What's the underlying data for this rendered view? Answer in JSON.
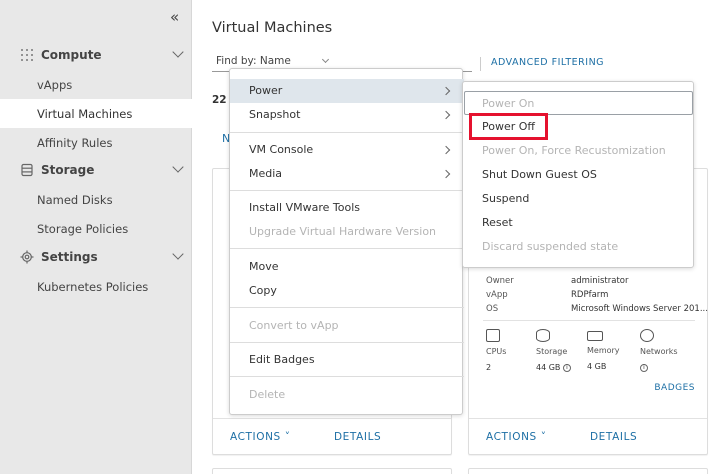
{
  "sidebar": {
    "collapse_glyph": "«",
    "groups": [
      {
        "label": "Compute",
        "icon": "grid-icon"
      },
      {
        "label": "Storage",
        "icon": "database-icon"
      },
      {
        "label": "Settings",
        "icon": "gear-icon"
      }
    ],
    "compute_items": [
      "vApps",
      "Virtual Machines",
      "Affinity Rules"
    ],
    "storage_items": [
      "Named Disks",
      "Storage Policies"
    ],
    "settings_items": [
      "Kubernetes Policies"
    ],
    "active_item": "Virtual Machines"
  },
  "main": {
    "title": "Virtual Machines",
    "find_by_label": "Find by:",
    "find_by_value": "Name",
    "advanced_filtering": "ADVANCED FILTERING",
    "count": "22",
    "new_vm_partial": "N"
  },
  "context_menu": {
    "items": [
      {
        "label": "Power",
        "submenu": true,
        "disabled": false,
        "highlighted": true
      },
      {
        "label": "Snapshot",
        "submenu": true,
        "disabled": false
      },
      {
        "label": "VM Console",
        "submenu": true,
        "disabled": false
      },
      {
        "label": "Media",
        "submenu": true,
        "disabled": false
      },
      {
        "label": "Install VMware Tools",
        "disabled": false
      },
      {
        "label": "Upgrade Virtual Hardware Version",
        "disabled": true
      },
      {
        "label": "Move",
        "disabled": false
      },
      {
        "label": "Copy",
        "disabled": false
      },
      {
        "label": "Convert to vApp",
        "disabled": true
      },
      {
        "label": "Edit Badges",
        "disabled": false
      },
      {
        "label": "Delete",
        "disabled": true
      }
    ]
  },
  "power_submenu": {
    "items": [
      {
        "label": "Power On",
        "disabled": true
      },
      {
        "label": "Power Off",
        "disabled": false
      },
      {
        "label": "Power On, Force Recustomization",
        "disabled": true
      },
      {
        "label": "Shut Down Guest OS",
        "disabled": false
      },
      {
        "label": "Suspend",
        "disabled": false
      },
      {
        "label": "Reset",
        "disabled": false
      },
      {
        "label": "Discard suspended state",
        "disabled": true
      }
    ]
  },
  "vm_card": {
    "owner_label": "Owner",
    "owner_value": "administrator",
    "vapp_label": "vApp",
    "vapp_value": "RDPfarm",
    "os_label": "OS",
    "os_value": "Microsoft Windows Server 201...",
    "resources": [
      {
        "label": "CPUs",
        "value": "2",
        "icon": "cpu-icon"
      },
      {
        "label": "Storage",
        "value": "44 GB",
        "icon": "storage-icon"
      },
      {
        "label": "Memory",
        "value": "4 GB",
        "icon": "memory-icon"
      },
      {
        "label": "Networks",
        "value": "",
        "icon": "network-icon"
      }
    ],
    "badges_label": "BADGES",
    "info_glyph": "i"
  },
  "card_actions": {
    "actions_label": "ACTIONS",
    "actions_caret": "˅",
    "details_label": "DETAILS"
  },
  "colors": {
    "accent": "#1d6fa5",
    "highlight_box": "#e5112e",
    "menu_hover": "#dfe6ec",
    "sidebar_bg": "#e8e8e8"
  }
}
